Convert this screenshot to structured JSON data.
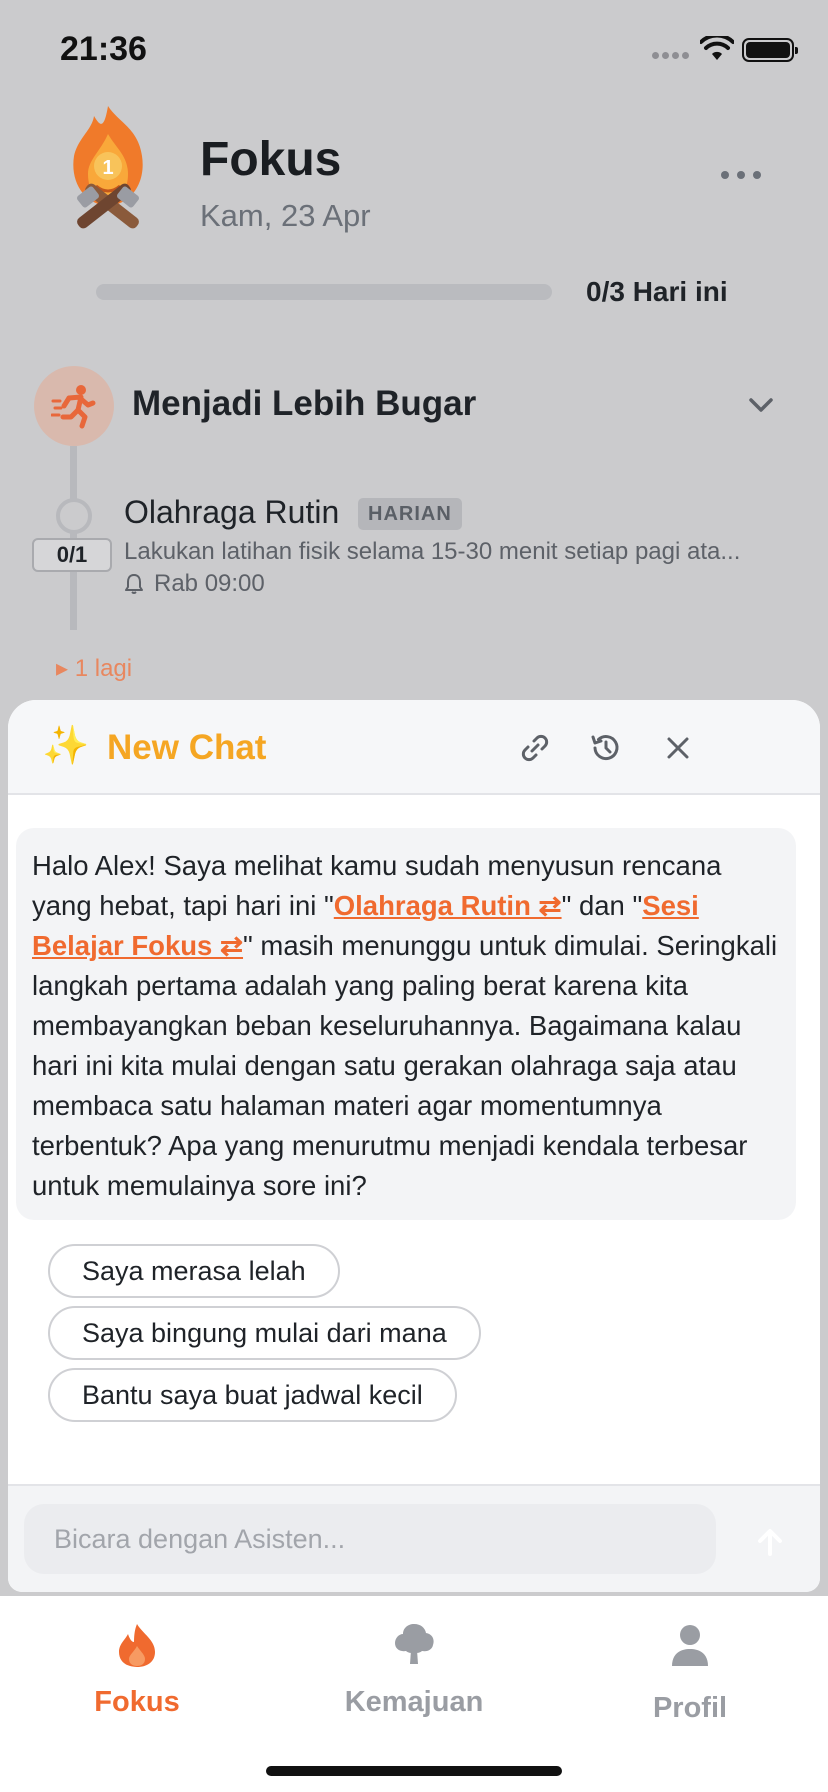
{
  "status_bar": {
    "time": "21:36"
  },
  "header": {
    "title": "Fokus",
    "date": "Kam, 23 Apr",
    "mascot_level": "1"
  },
  "progress": {
    "completed": 0,
    "total": 3,
    "label": "0/3 Hari ini"
  },
  "goal": {
    "title": "Menjadi Lebih Bugar",
    "icon": "running-person-icon",
    "habits": [
      {
        "name": "Olahraga Rutin",
        "tag": "HARIAN",
        "count": "0/1",
        "description": "Lakukan latihan fisik selama 15-30 menit setiap pagi ata...",
        "reminder": "Rab 09:00"
      }
    ],
    "more_label": "▸ 1 lagi"
  },
  "chat": {
    "title": "New Chat",
    "message": {
      "p1": "Halo Alex! Saya melihat kamu sudah menyusun rencana yang hebat, tapi hari ini \"",
      "link1": "Olahraga Rutin ⇄",
      "p2": "\" dan \"",
      "link2": "Sesi Belajar Fokus ⇄",
      "p3": "\" masih menunggu untuk dimulai. Seringkali langkah pertama adalah yang paling berat karena kita membayangkan beban keseluruhannya. Bagaimana kalau hari ini kita mulai dengan satu gerakan olahraga saja atau membaca satu halaman materi agar momentumnya terbentuk? Apa yang menurutmu menjadi kendala terbesar untuk memulainya sore ini?"
    },
    "suggestions": [
      "Saya merasa lelah",
      "Saya bingung mulai dari mana",
      "Bantu saya buat jadwal kecil"
    ],
    "input_placeholder": "Bicara dengan Asisten..."
  },
  "tabs": [
    {
      "label": "Fokus",
      "icon": "flame-icon",
      "active": true
    },
    {
      "label": "Kemajuan",
      "icon": "tree-icon",
      "active": false
    },
    {
      "label": "Profil",
      "icon": "person-icon",
      "active": false
    }
  ],
  "colors": {
    "accent": "#f06a2f",
    "chat_title": "#f5a623",
    "inactive_tab": "#9a9da3"
  }
}
